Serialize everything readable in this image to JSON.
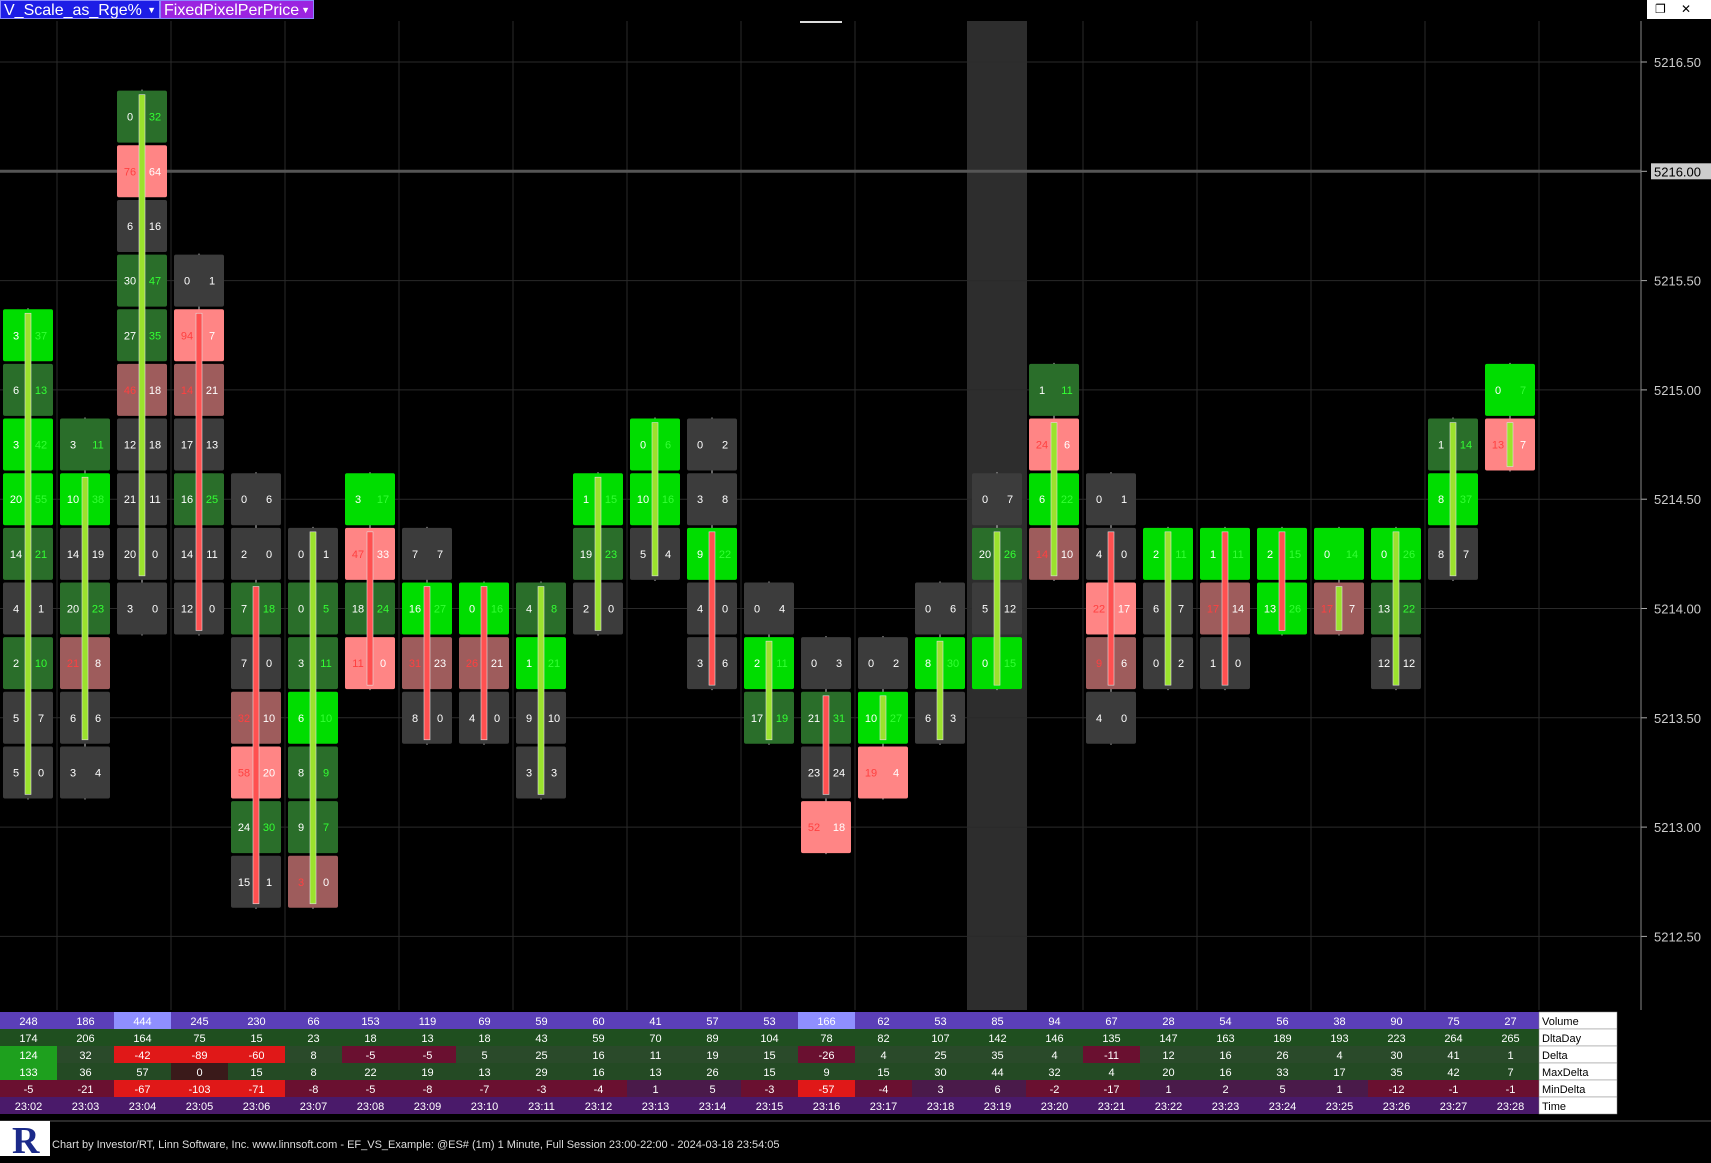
{
  "toolbar": {
    "scale_mode": "V_Scale_as_Rge%",
    "pixel_mode": "FixedPixelPerPrice"
  },
  "status_bar": {
    "text": "Chart by Investor/RT, Linn Software, Inc. www.linnsoft.com - EF_VS_Example: @ES# (1m) 1 Minute, Full Session 23:00-22:00 - 2024-03-18 23:54:05"
  },
  "price_axis": {
    "ticks": [
      "5216.50",
      "5216.00",
      "5215.50",
      "5215.00",
      "5214.50",
      "5214.00",
      "5213.50",
      "5213.00",
      "5212.50"
    ],
    "highlighted_price": "5216.00"
  },
  "colors": {
    "strong_green": "#00e000",
    "dark_green": "#2a6e2a",
    "strong_red": "#ff8080",
    "muted_red": "#a06060",
    "gray": "#404040",
    "ask_text": "#33ff33",
    "bid_text": "#ff3333"
  },
  "candles": [
    {
      "time": "23:02",
      "levels": [
        [
          5215.25,
          "3",
          "37",
          "sg"
        ],
        [
          5215.0,
          "6",
          "13",
          "dg"
        ],
        [
          5214.75,
          "3",
          "42",
          "sg"
        ],
        [
          5214.5,
          "20",
          "55",
          "sg"
        ],
        [
          5214.25,
          "14",
          "21",
          "dg"
        ],
        [
          5214.0,
          "4",
          "1",
          "gy"
        ],
        [
          5213.75,
          "2",
          "10",
          "dg"
        ],
        [
          5213.5,
          "5",
          "7",
          "gy"
        ],
        [
          5213.25,
          "5",
          "0",
          "gy"
        ]
      ],
      "open": 5213.25,
      "close": 5215.25
    },
    {
      "time": "23:03",
      "levels": [
        [
          5214.75,
          "3",
          "11",
          "dg"
        ],
        [
          5214.5,
          "10",
          "38",
          "sg"
        ],
        [
          5214.25,
          "14",
          "19",
          "gy"
        ],
        [
          5214.0,
          "20",
          "23",
          "dg"
        ],
        [
          5213.75,
          "21",
          "8",
          "mr"
        ],
        [
          5213.5,
          "6",
          "6",
          "gy"
        ],
        [
          5213.25,
          "3",
          "4",
          "gy"
        ]
      ],
      "open": 5213.5,
      "close": 5214.5
    },
    {
      "time": "23:04",
      "levels": [
        [
          5216.25,
          "0",
          "32",
          "dg"
        ],
        [
          5216.0,
          "76",
          "64",
          "sr"
        ],
        [
          5215.75,
          "6",
          "16",
          "gy"
        ],
        [
          5215.5,
          "30",
          "47",
          "dg"
        ],
        [
          5215.25,
          "27",
          "35",
          "dg"
        ],
        [
          5215.0,
          "46",
          "18",
          "mr"
        ],
        [
          5214.75,
          "12",
          "18",
          "gy"
        ],
        [
          5214.5,
          "21",
          "11",
          "gy"
        ],
        [
          5214.25,
          "20",
          "0",
          "gy"
        ],
        [
          5214.0,
          "3",
          "0",
          "gy"
        ]
      ],
      "open": 5214.25,
      "close": 5216.25
    },
    {
      "time": "23:05",
      "levels": [
        [
          5215.5,
          "0",
          "1",
          "gy"
        ],
        [
          5215.25,
          "94",
          "7",
          "sr"
        ],
        [
          5215.0,
          "14",
          "21",
          "mr"
        ],
        [
          5214.75,
          "17",
          "13",
          "gy"
        ],
        [
          5214.5,
          "16",
          "25",
          "dg"
        ],
        [
          5214.25,
          "14",
          "11",
          "gy"
        ],
        [
          5214.0,
          "12",
          "0",
          "gy"
        ]
      ],
      "open": 5215.25,
      "close": 5214.0
    },
    {
      "time": "23:06",
      "levels": [
        [
          5214.5,
          "0",
          "6",
          "gy"
        ],
        [
          5214.25,
          "2",
          "0",
          "gy"
        ],
        [
          5214.0,
          "7",
          "18",
          "dg"
        ],
        [
          5213.75,
          "7",
          "0",
          "gy"
        ],
        [
          5213.5,
          "32",
          "10",
          "mr"
        ],
        [
          5213.25,
          "58",
          "20",
          "sr"
        ],
        [
          5213.0,
          "24",
          "30",
          "dg"
        ],
        [
          5212.75,
          "15",
          "1",
          "gy"
        ]
      ],
      "open": 5214.0,
      "close": 5212.75
    },
    {
      "time": "23:07",
      "levels": [
        [
          5214.25,
          "0",
          "1",
          "gy"
        ],
        [
          5214.0,
          "0",
          "5",
          "dg"
        ],
        [
          5213.75,
          "3",
          "11",
          "dg"
        ],
        [
          5213.5,
          "6",
          "10",
          "sg"
        ],
        [
          5213.25,
          "8",
          "9",
          "dg"
        ],
        [
          5213.0,
          "9",
          "7",
          "dg"
        ],
        [
          5212.75,
          "3",
          "0",
          "mr"
        ]
      ],
      "open": 5212.75,
      "close": 5214.25
    },
    {
      "time": "23:08",
      "levels": [
        [
          5214.5,
          "3",
          "17",
          "sg"
        ],
        [
          5214.25,
          "47",
          "33",
          "sr"
        ],
        [
          5214.0,
          "18",
          "24",
          "dg"
        ],
        [
          5213.75,
          "11",
          "0",
          "sr"
        ]
      ],
      "open": 5214.25,
      "close": 5213.75
    },
    {
      "time": "23:09",
      "levels": [
        [
          5214.25,
          "7",
          "7",
          "gy"
        ],
        [
          5214.0,
          "16",
          "27",
          "sg"
        ],
        [
          5213.75,
          "31",
          "23",
          "mr"
        ],
        [
          5213.5,
          "8",
          "0",
          "gy"
        ]
      ],
      "open": 5214.0,
      "close": 5213.5
    },
    {
      "time": "23:10",
      "levels": [
        [
          5214.0,
          "0",
          "16",
          "sg"
        ],
        [
          5213.75,
          "26",
          "21",
          "mr"
        ],
        [
          5213.5,
          "4",
          "0",
          "gy"
        ]
      ],
      "open": 5214.0,
      "close": 5213.5
    },
    {
      "time": "23:11",
      "levels": [
        [
          5214.0,
          "4",
          "8",
          "dg"
        ],
        [
          5213.75,
          "1",
          "21",
          "sg"
        ],
        [
          5213.5,
          "9",
          "10",
          "gy"
        ],
        [
          5213.25,
          "3",
          "3",
          "gy"
        ]
      ],
      "open": 5213.25,
      "close": 5214.0
    },
    {
      "time": "23:12",
      "levels": [
        [
          5214.5,
          "1",
          "15",
          "sg"
        ],
        [
          5214.25,
          "19",
          "23",
          "dg"
        ],
        [
          5214.0,
          "2",
          "0",
          "gy"
        ]
      ],
      "open": 5214.0,
      "close": 5214.5
    },
    {
      "time": "23:13",
      "levels": [
        [
          5214.75,
          "0",
          "6",
          "sg"
        ],
        [
          5214.5,
          "10",
          "16",
          "sg"
        ],
        [
          5214.25,
          "5",
          "4",
          "gy"
        ]
      ],
      "open": 5214.25,
      "close": 5214.75
    },
    {
      "time": "23:14",
      "levels": [
        [
          5214.75,
          "0",
          "2",
          "gy"
        ],
        [
          5214.5,
          "3",
          "8",
          "gy"
        ],
        [
          5214.25,
          "9",
          "22",
          "sg"
        ],
        [
          5214.0,
          "4",
          "0",
          "gy"
        ],
        [
          5213.75,
          "3",
          "6",
          "gy"
        ]
      ],
      "open": 5214.25,
      "close": 5213.75
    },
    {
      "time": "23:15",
      "levels": [
        [
          5214.0,
          "0",
          "4",
          "gy"
        ],
        [
          5213.75,
          "2",
          "11",
          "sg"
        ],
        [
          5213.5,
          "17",
          "19",
          "dg"
        ]
      ],
      "open": 5213.5,
      "close": 5213.75
    },
    {
      "time": "23:16",
      "levels": [
        [
          5213.75,
          "0",
          "3",
          "gy"
        ],
        [
          5213.5,
          "21",
          "31",
          "dg"
        ],
        [
          5213.25,
          "23",
          "24",
          "gy"
        ],
        [
          5213.0,
          "52",
          "18",
          "sr"
        ]
      ],
      "open": 5213.5,
      "close": 5213.25
    },
    {
      "time": "23:17",
      "levels": [
        [
          5213.75,
          "0",
          "2",
          "gy"
        ],
        [
          5213.5,
          "10",
          "27",
          "sg"
        ],
        [
          5213.25,
          "19",
          "4",
          "sr"
        ]
      ],
      "open": 5213.5,
      "close": 5213.5
    },
    {
      "time": "23:18",
      "levels": [
        [
          5214.0,
          "0",
          "6",
          "gy"
        ],
        [
          5213.75,
          "8",
          "30",
          "sg"
        ],
        [
          5213.5,
          "6",
          "3",
          "gy"
        ]
      ],
      "open": 5213.5,
      "close": 5213.75
    },
    {
      "time": "23:19",
      "levels": [
        [
          5214.5,
          "0",
          "7",
          "gy"
        ],
        [
          5214.25,
          "20",
          "26",
          "dg"
        ],
        [
          5214.0,
          "5",
          "12",
          "gy"
        ],
        [
          5213.75,
          "0",
          "15",
          "sg"
        ]
      ],
      "open": 5213.75,
      "close": 5214.25
    },
    {
      "time": "23:20",
      "levels": [
        [
          5215.0,
          "1",
          "11",
          "dg"
        ],
        [
          5214.75,
          "24",
          "6",
          "sr"
        ],
        [
          5214.5,
          "6",
          "22",
          "sg"
        ],
        [
          5214.25,
          "14",
          "10",
          "mr"
        ]
      ],
      "open": 5214.25,
      "close": 5214.75
    },
    {
      "time": "23:21",
      "levels": [
        [
          5214.5,
          "0",
          "1",
          "gy"
        ],
        [
          5214.25,
          "4",
          "0",
          "gy"
        ],
        [
          5214.0,
          "22",
          "17",
          "sr"
        ],
        [
          5213.75,
          "9",
          "6",
          "mr"
        ],
        [
          5213.5,
          "4",
          "0",
          "gy"
        ]
      ],
      "open": 5214.25,
      "close": 5213.75
    },
    {
      "time": "23:22",
      "levels": [
        [
          5214.25,
          "2",
          "11",
          "sg"
        ],
        [
          5214.0,
          "6",
          "7",
          "gy"
        ],
        [
          5213.75,
          "0",
          "2",
          "gy"
        ]
      ],
      "open": 5213.75,
      "close": 5214.25
    },
    {
      "time": "23:23",
      "levels": [
        [
          5214.25,
          "1",
          "11",
          "sg"
        ],
        [
          5214.0,
          "17",
          "14",
          "mr"
        ],
        [
          5213.75,
          "1",
          "0",
          "gy"
        ]
      ],
      "open": 5214.25,
      "close": 5213.75
    },
    {
      "time": "23:24",
      "levels": [
        [
          5214.25,
          "2",
          "15",
          "sg"
        ],
        [
          5214.0,
          "13",
          "26",
          "sg"
        ]
      ],
      "open": 5214.25,
      "close": 5214.0
    },
    {
      "time": "23:25",
      "levels": [
        [
          5214.25,
          "0",
          "14",
          "sg"
        ],
        [
          5214.0,
          "17",
          "7",
          "mr"
        ]
      ],
      "open": 5214.0,
      "close": 5214.0
    },
    {
      "time": "23:26",
      "levels": [
        [
          5214.25,
          "0",
          "26",
          "sg"
        ],
        [
          5214.0,
          "13",
          "22",
          "dg"
        ],
        [
          5213.75,
          "12",
          "12",
          "gy"
        ]
      ],
      "open": 5213.75,
      "close": 5214.25
    },
    {
      "time": "23:27",
      "levels": [
        [
          5214.75,
          "1",
          "14",
          "dg"
        ],
        [
          5214.5,
          "8",
          "37",
          "sg"
        ],
        [
          5214.25,
          "8",
          "7",
          "gy"
        ]
      ],
      "open": 5214.25,
      "close": 5214.75
    },
    {
      "time": "23:28",
      "levels": [
        [
          5215.0,
          "0",
          "7",
          "sg"
        ],
        [
          5214.75,
          "13",
          "7",
          "sr"
        ]
      ],
      "open": 5214.75,
      "close": 5214.75
    }
  ],
  "table": {
    "row_labels": [
      "Volume",
      "DltaDay",
      "Delta",
      "MaxDelta",
      "MinDelta",
      "Time"
    ],
    "rows": {
      "Volume": [
        "248",
        "186",
        "444",
        "245",
        "230",
        "66",
        "153",
        "119",
        "69",
        "59",
        "60",
        "41",
        "57",
        "53",
        "166",
        "62",
        "53",
        "85",
        "94",
        "67",
        "28",
        "54",
        "56",
        "38",
        "90",
        "75",
        "27"
      ],
      "DltaDay": [
        "174",
        "206",
        "164",
        "75",
        "15",
        "23",
        "18",
        "13",
        "18",
        "43",
        "59",
        "70",
        "89",
        "104",
        "78",
        "82",
        "107",
        "142",
        "146",
        "135",
        "147",
        "163",
        "189",
        "193",
        "223",
        "264",
        "265"
      ],
      "Delta": [
        "124",
        "32",
        "-42",
        "-89",
        "-60",
        "8",
        "-5",
        "-5",
        "5",
        "25",
        "16",
        "11",
        "19",
        "15",
        "-26",
        "4",
        "25",
        "35",
        "4",
        "-11",
        "12",
        "16",
        "26",
        "4",
        "30",
        "41",
        "1"
      ],
      "MaxDelta": [
        "133",
        "36",
        "57",
        "0",
        "15",
        "8",
        "22",
        "19",
        "13",
        "29",
        "16",
        "13",
        "26",
        "15",
        "9",
        "15",
        "30",
        "44",
        "32",
        "4",
        "20",
        "16",
        "33",
        "17",
        "35",
        "42",
        "7"
      ],
      "MinDelta": [
        "-5",
        "-21",
        "-67",
        "-103",
        "-71",
        "-8",
        "-5",
        "-8",
        "-7",
        "-3",
        "-4",
        "1",
        "5",
        "-3",
        "-57",
        "-4",
        "3",
        "6",
        "-2",
        "-17",
        "1",
        "2",
        "5",
        "1",
        "-12",
        "-1",
        "-1"
      ],
      "Time": [
        "23:02",
        "23:03",
        "23:04",
        "23:05",
        "23:06",
        "23:07",
        "23:08",
        "23:09",
        "23:10",
        "23:11",
        "23:12",
        "23:13",
        "23:14",
        "23:15",
        "23:16",
        "23:17",
        "23:18",
        "23:19",
        "23:20",
        "23:21",
        "23:22",
        "23:23",
        "23:24",
        "23:25",
        "23:26",
        "23:27",
        "23:28"
      ]
    }
  }
}
